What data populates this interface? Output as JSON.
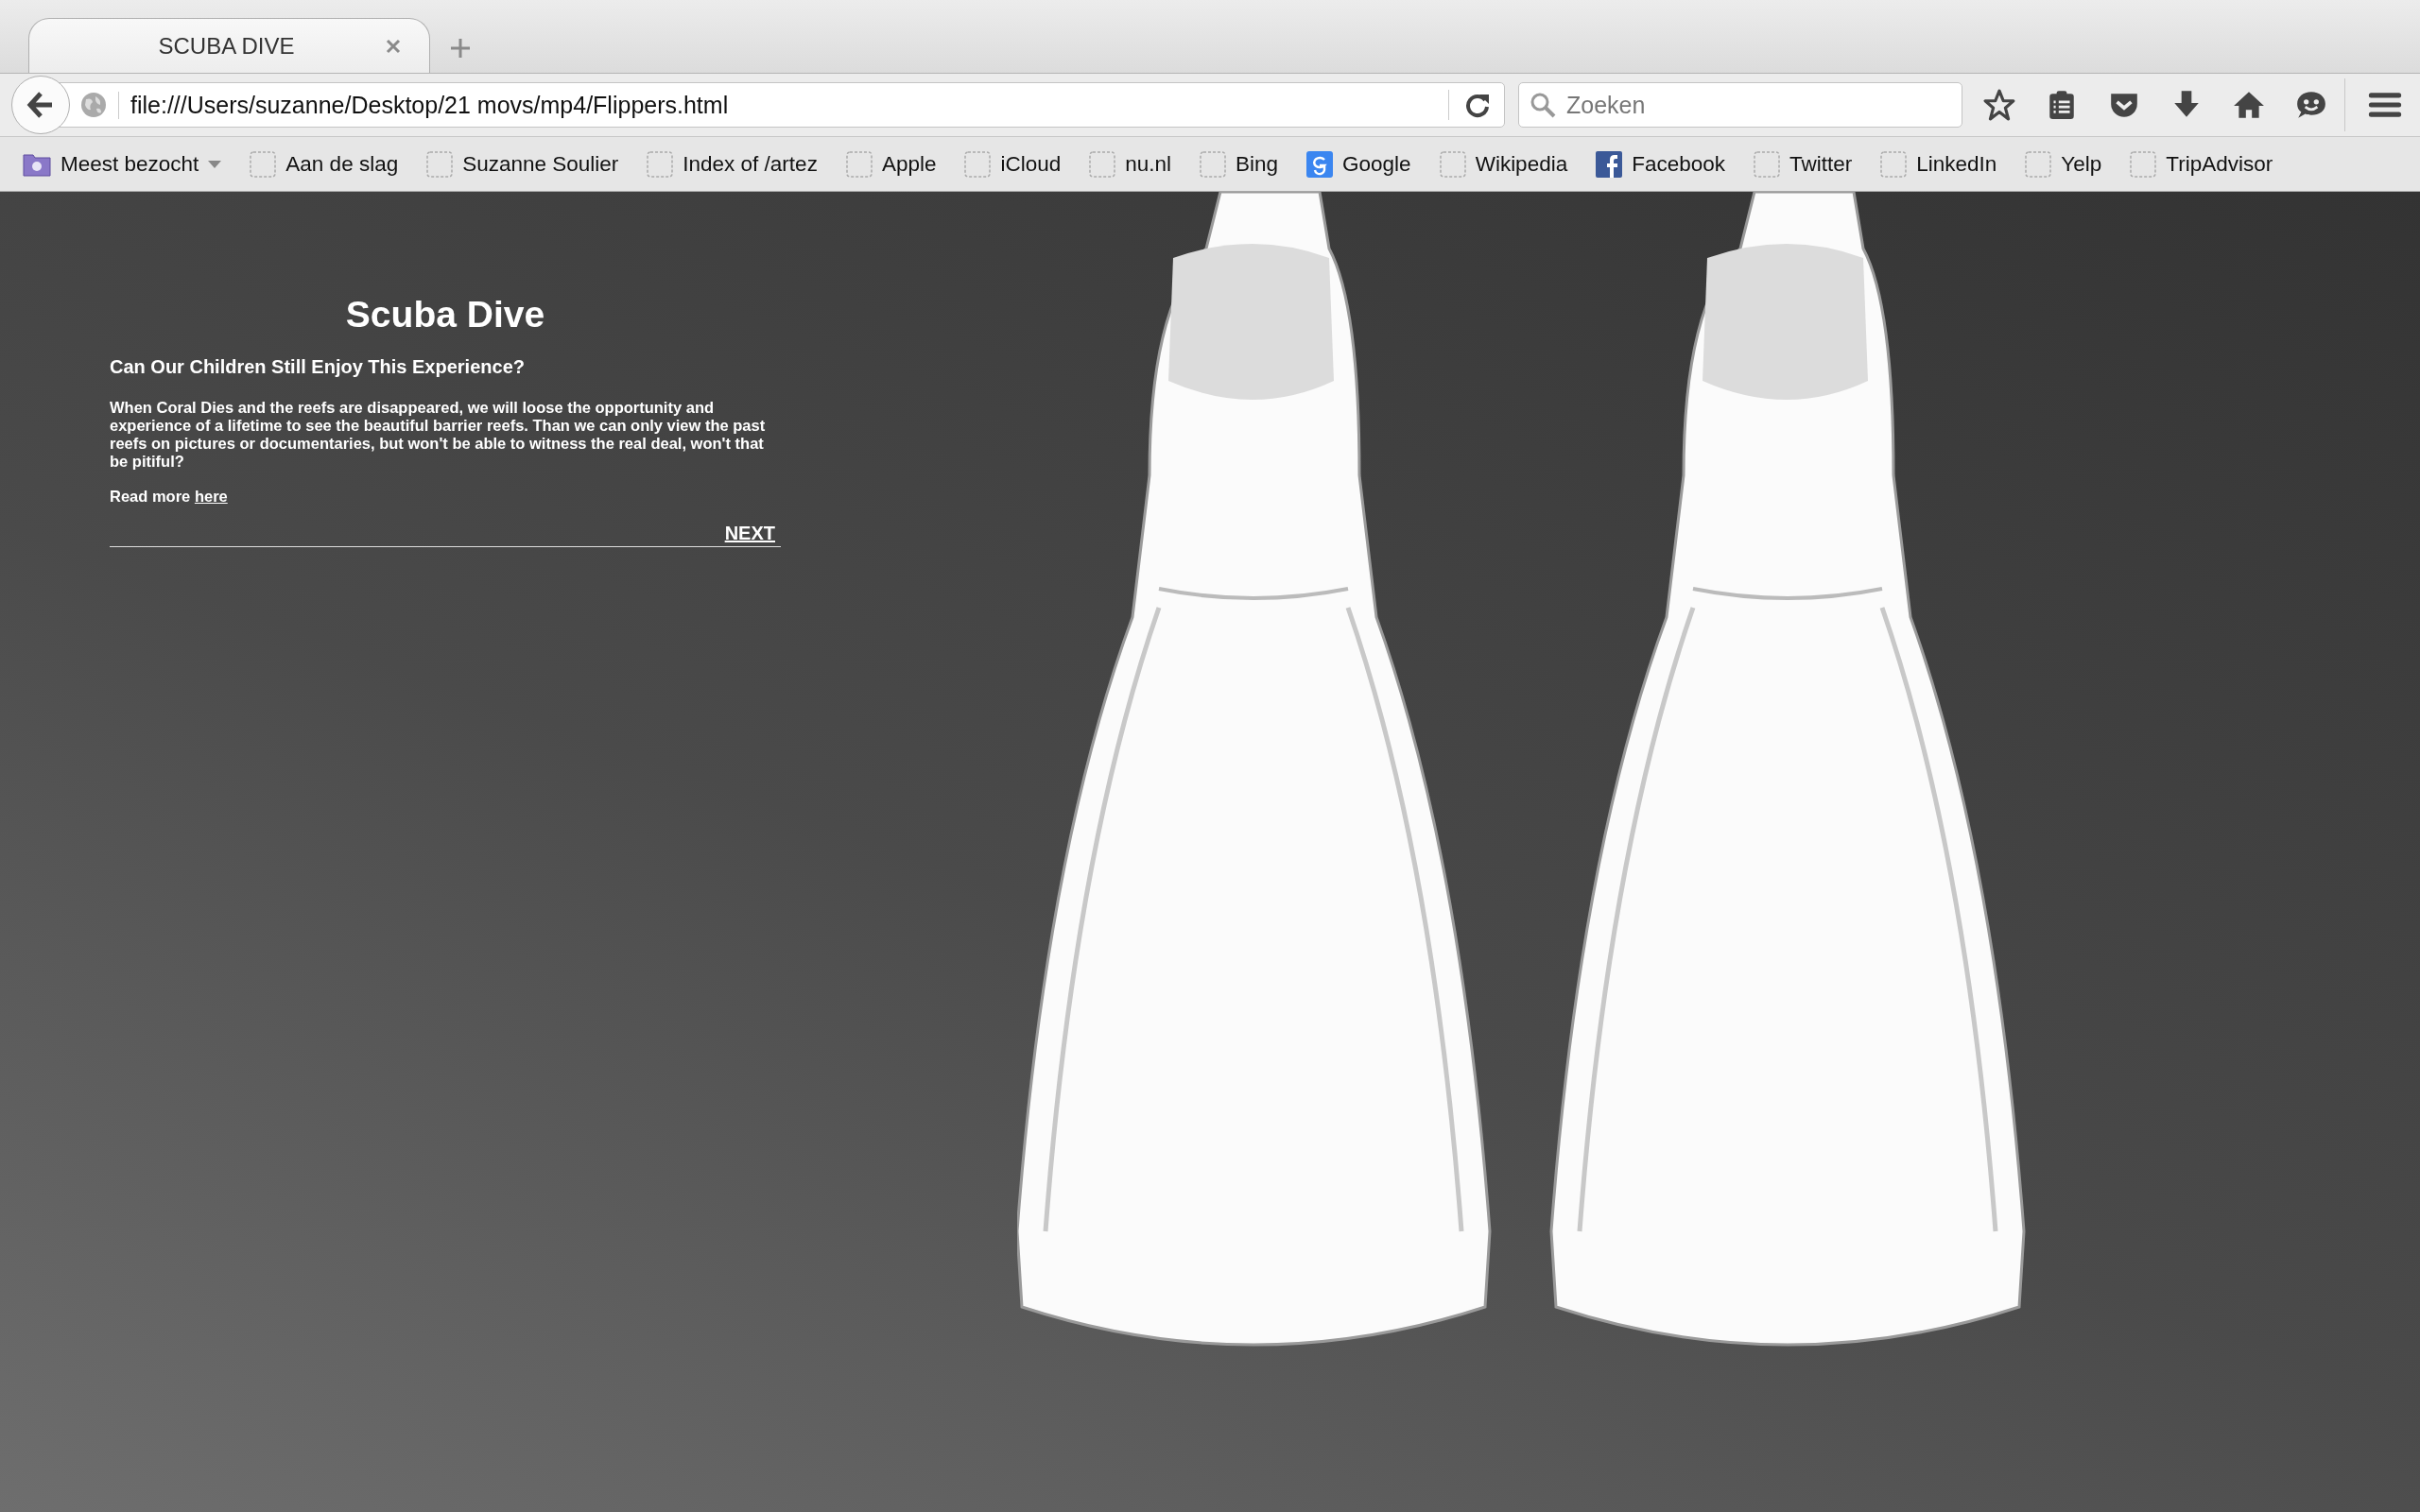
{
  "tabs": [
    {
      "title": "SCUBA DIVE",
      "selected": true
    }
  ],
  "address_bar": {
    "url": "file:///Users/suzanne/Desktop/21 movs/mp4/Flippers.html"
  },
  "search": {
    "placeholder": "Zoeken"
  },
  "bookmarks": [
    {
      "label": "Meest bezocht",
      "kind": "folder"
    },
    {
      "label": "Aan de slag",
      "kind": "page"
    },
    {
      "label": "Suzanne Soulier",
      "kind": "page"
    },
    {
      "label": "Index of /artez",
      "kind": "page"
    },
    {
      "label": "Apple",
      "kind": "page"
    },
    {
      "label": "iCloud",
      "kind": "page"
    },
    {
      "label": "nu.nl",
      "kind": "page"
    },
    {
      "label": "Bing",
      "kind": "page"
    },
    {
      "label": "Google",
      "kind": "google"
    },
    {
      "label": "Wikipedia",
      "kind": "page"
    },
    {
      "label": "Facebook",
      "kind": "facebook"
    },
    {
      "label": "Twitter",
      "kind": "page"
    },
    {
      "label": "LinkedIn",
      "kind": "page"
    },
    {
      "label": "Yelp",
      "kind": "page"
    },
    {
      "label": "TripAdvisor",
      "kind": "page"
    }
  ],
  "page": {
    "title": "Scuba Dive",
    "subtitle": "Can Our Children Still Enjoy This Experience?",
    "body": "When Coral Dies and the reefs are disappeared, we will loose the opportunity and experience of a lifetime to see the beautiful barrier reefs. Than we can only view the past reefs on pictures or documentaries, but won't be able to witness the real deal, won't that be pitiful?",
    "read_more": "Read more",
    "read_more_link": "here",
    "next": "NEXT"
  }
}
